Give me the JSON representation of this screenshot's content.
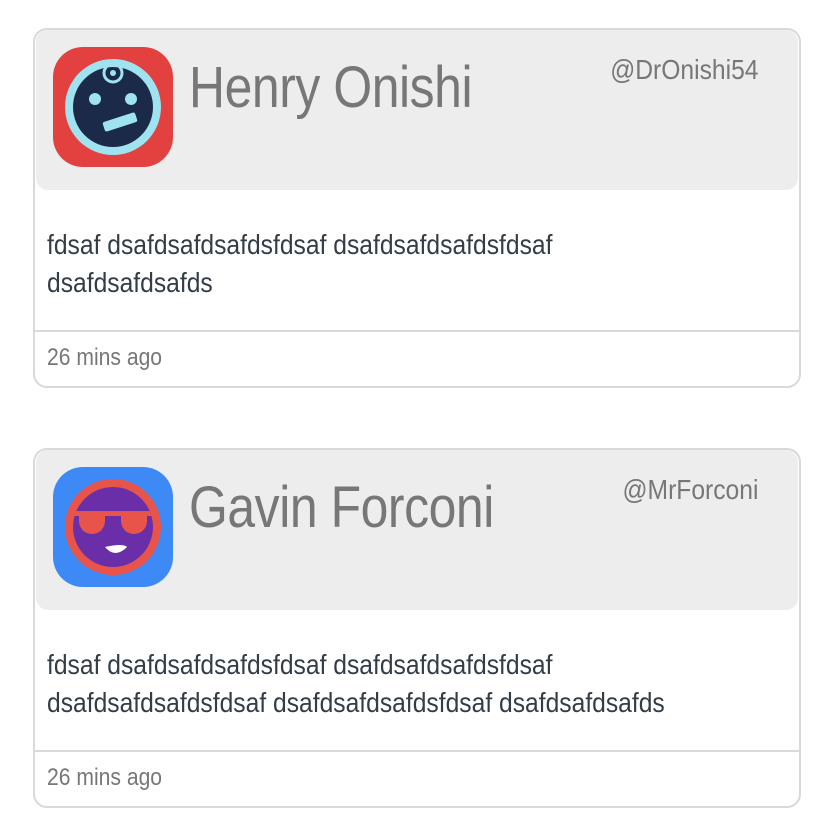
{
  "tweets": [
    {
      "avatar_icon": "robot-face-icon",
      "avatar_colors": {
        "border": "#e2413f",
        "ring": "#9fe2f0",
        "face": "#1c2a4a"
      },
      "name": "Henry Onishi",
      "handle": "@DrOnishi54",
      "body": "fdsaf dsafdsafdsafdsfdsaf dsafdsafdsafdsfdsaf dsafdsafdsafds",
      "time": "26 mins ago"
    },
    {
      "avatar_icon": "sunglasses-face-icon",
      "avatar_colors": {
        "border": "#3d8af7",
        "ring": "#e8544a",
        "face": "#6a2fa8"
      },
      "name": "Gavin Forconi",
      "handle": "@MrForconi",
      "body": "fdsaf dsafdsafdsafdsfdsaf dsafdsafdsafdsfdsaf dsafdsafdsafdsfdsaf dsafdsafdsafdsfdsaf dsafdsafdsafds",
      "time": "26 mins ago"
    }
  ]
}
